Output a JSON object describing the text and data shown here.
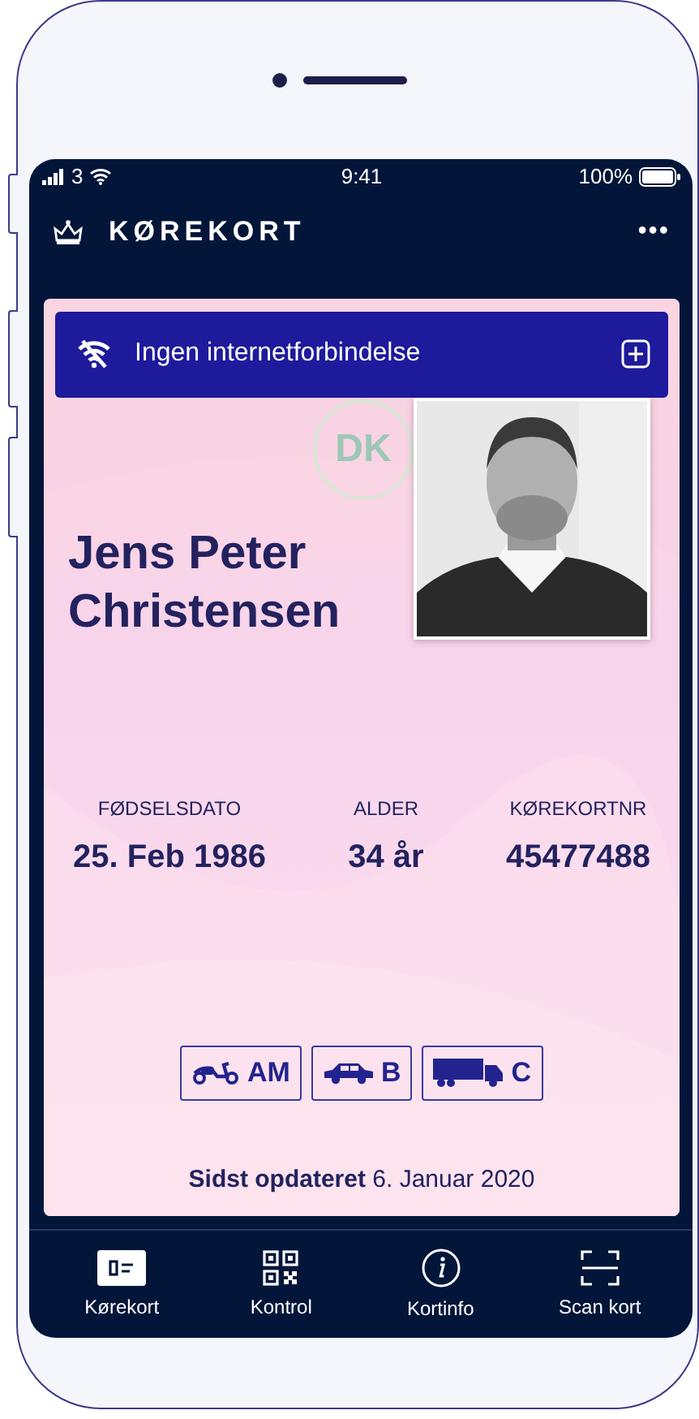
{
  "status_bar": {
    "carrier": "3",
    "time": "9:41",
    "battery": "100%"
  },
  "header": {
    "title": "KØREKORT",
    "menu": "•••"
  },
  "banner": {
    "text": "Ingen internetforbindelse"
  },
  "card": {
    "seal": "DK",
    "name": [
      "Jens Peter",
      "Christensen"
    ],
    "fields": [
      {
        "label": "FØDSELSDATO",
        "value": "25. Feb 1986"
      },
      {
        "label": "ALDER",
        "value": "34 år"
      },
      {
        "label": "KØREKORTNR",
        "value": "45477488"
      }
    ],
    "categories": [
      {
        "kind": "scooter",
        "label": "AM"
      },
      {
        "kind": "car",
        "label": "B"
      },
      {
        "kind": "truck",
        "label": "C"
      }
    ],
    "updated": "**Sidst opdateret** 6. Januar 2020"
  },
  "tabs": [
    {
      "kind": "card",
      "label": "Kørekort",
      "selected": true
    },
    {
      "kind": "qr",
      "label": "Kontrol",
      "selected": false
    },
    {
      "kind": "info",
      "label": "Kortinfo",
      "selected": false
    },
    {
      "kind": "scan",
      "label": "Scan kort",
      "selected": false
    }
  ]
}
